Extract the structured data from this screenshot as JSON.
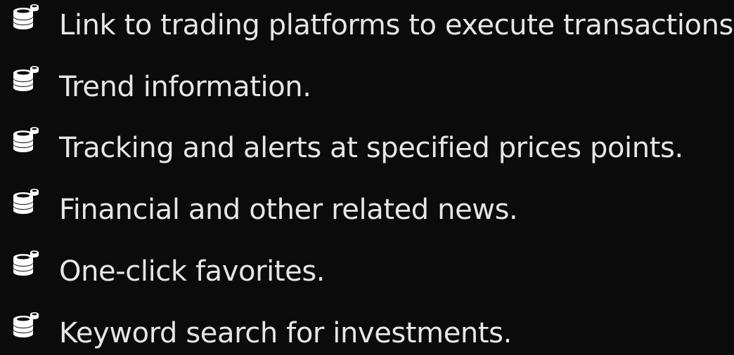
{
  "slide": {
    "bullet_icon": "coin-stack-icon",
    "colors": {
      "background": "#0b0b0b",
      "text": "#e6e6e6",
      "icon": "#ffffff"
    },
    "items": [
      {
        "label": "Link to trading platforms to execute transactions."
      },
      {
        "label": "Trend information."
      },
      {
        "label": "Tracking and alerts at specified prices points."
      },
      {
        "label": "Financial and other related news."
      },
      {
        "label": "One-click favorites."
      },
      {
        "label": "Keyword search for investments."
      }
    ]
  }
}
